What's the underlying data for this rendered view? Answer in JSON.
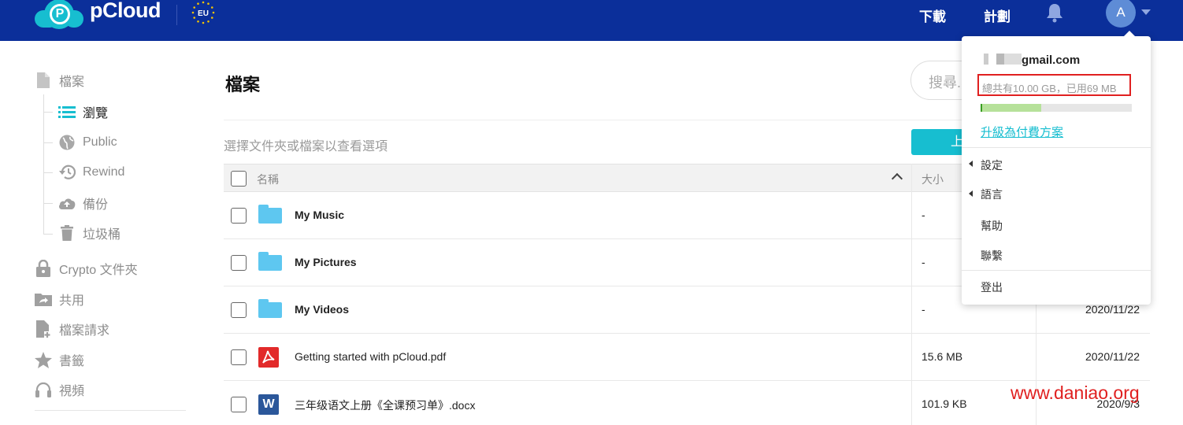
{
  "header": {
    "logo_text": "pCloud",
    "region_badge": "EU",
    "download_label": "下載",
    "plans_label": "計劃",
    "avatar_initial": "A"
  },
  "sidebar": {
    "files_label": "檔案",
    "sub_items": [
      {
        "label": "瀏覽",
        "icon": "list-icon",
        "active": true
      },
      {
        "label": "Public",
        "icon": "globe-icon",
        "active": false
      },
      {
        "label": "Rewind",
        "icon": "history-icon",
        "active": false
      },
      {
        "label": "備份",
        "icon": "cloud-upload-icon",
        "active": false
      },
      {
        "label": "垃圾桶",
        "icon": "trash-icon",
        "active": false
      }
    ],
    "items": [
      {
        "label": "Crypto 文件夾",
        "icon": "lock-icon"
      },
      {
        "label": "共用",
        "icon": "share-folder-icon"
      },
      {
        "label": "檔案請求",
        "icon": "file-request-icon"
      },
      {
        "label": "書籤",
        "icon": "star-icon"
      },
      {
        "label": "視頻",
        "icon": "headphones-icon"
      }
    ]
  },
  "main": {
    "title": "檔案",
    "search_placeholder": "搜尋...",
    "hint": "選擇文件夾或檔案以查看選項",
    "upload_label": "上",
    "columns": {
      "name": "名稱",
      "size": "大小"
    },
    "rows": [
      {
        "name": "My Music",
        "type": "folder",
        "size": "-",
        "date": ""
      },
      {
        "name": "My Pictures",
        "type": "folder",
        "size": "-",
        "date": ""
      },
      {
        "name": "My Videos",
        "type": "folder",
        "size": "-",
        "date": "2020/11/22"
      },
      {
        "name": "Getting started with pCloud.pdf",
        "type": "pdf",
        "size": "15.6 MB",
        "date": "2020/11/22"
      },
      {
        "name": "三年级语文上册《全课预习单》.docx",
        "type": "docx",
        "size": "101.9 KB",
        "date": "2020/9/3"
      }
    ]
  },
  "account_menu": {
    "email_visible": "gmail.com",
    "quota": "總共有10.00 GB，已用69 MB",
    "quota_used_fraction": 0.0069,
    "upgrade_label": "升級為付費方案",
    "settings_label": "設定",
    "language_label": "語言",
    "help_label": "幫助",
    "contact_label": "聯繫",
    "logout_label": "登出"
  },
  "watermark": "www.daniao.org",
  "colors": {
    "topbar": "#0b2f9a",
    "accent": "#17bed0",
    "folder": "#5ec7f0",
    "highlight_border": "#e02020"
  }
}
